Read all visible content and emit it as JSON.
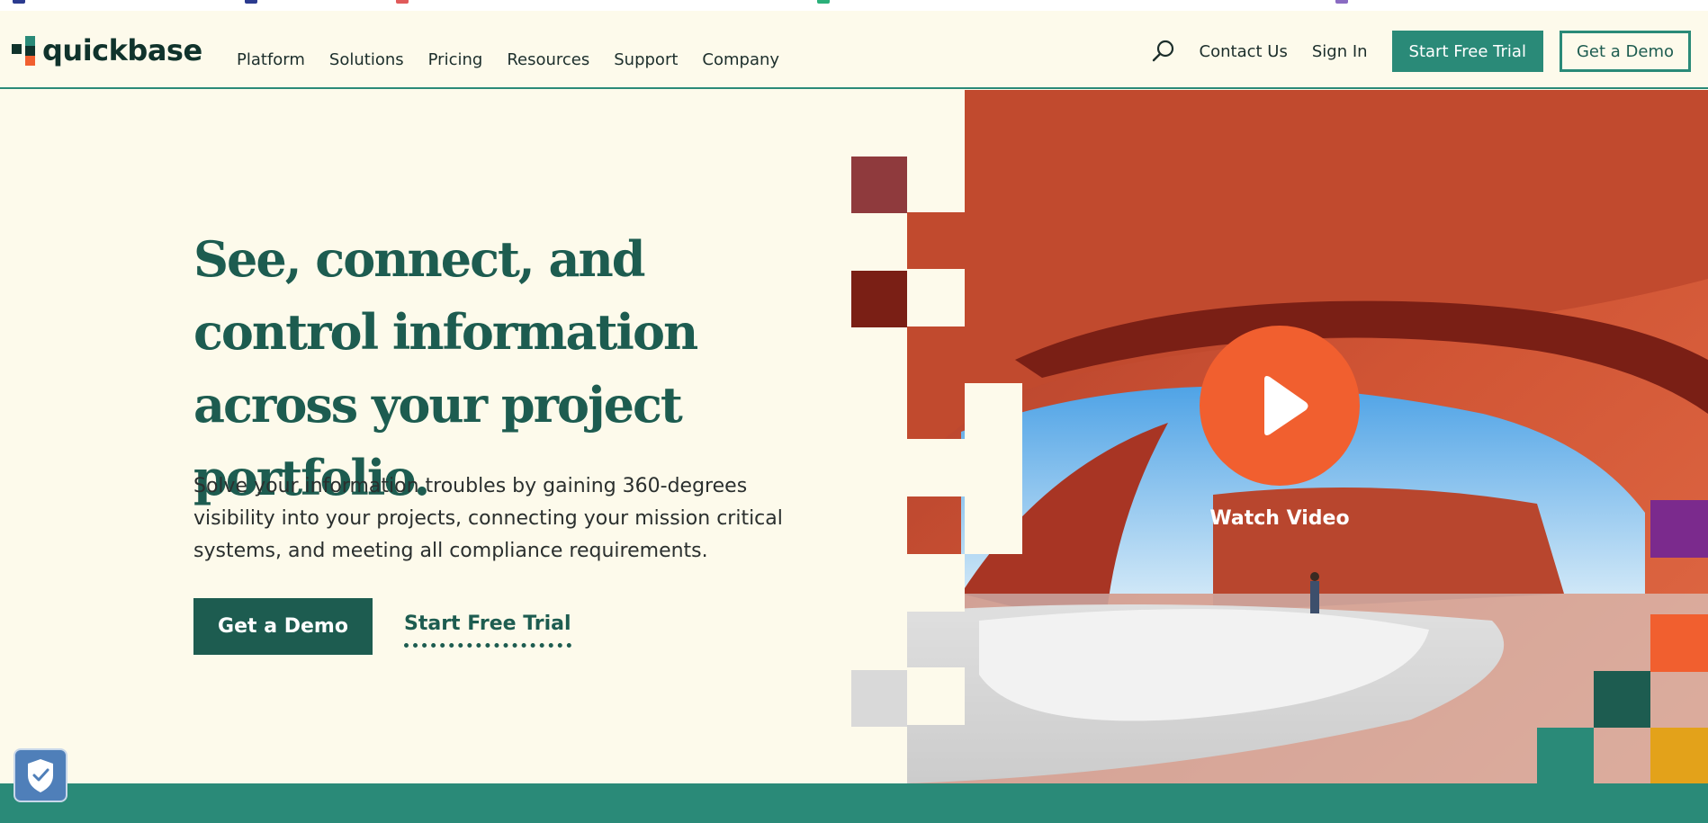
{
  "brand": {
    "name": "quickbase",
    "accent": "#2a8a78",
    "dark_green": "#1d5c50",
    "orange": "#f15f2f",
    "cream": "#fdfaeb"
  },
  "nav": {
    "menu": [
      "Platform",
      "Solutions",
      "Pricing",
      "Resources",
      "Support",
      "Company"
    ],
    "search_icon": "search-icon",
    "contact": "Contact Us",
    "sign_in": "Sign In",
    "trial": "Start Free Trial",
    "demo": "Get a Demo"
  },
  "hero": {
    "title": "See, connect, and control information across your project portfolio.",
    "subtitle": "Solve your information troubles by gaining 360-degrees visibility into your projects, connecting your mission critical systems, and meeting all compliance requirements.",
    "cta_demo": "Get a Demo",
    "cta_trial": "Start Free Trial",
    "video_label": "Watch Video",
    "play_icon": "play-icon"
  },
  "privacy": {
    "icon": "shield-check-icon"
  }
}
